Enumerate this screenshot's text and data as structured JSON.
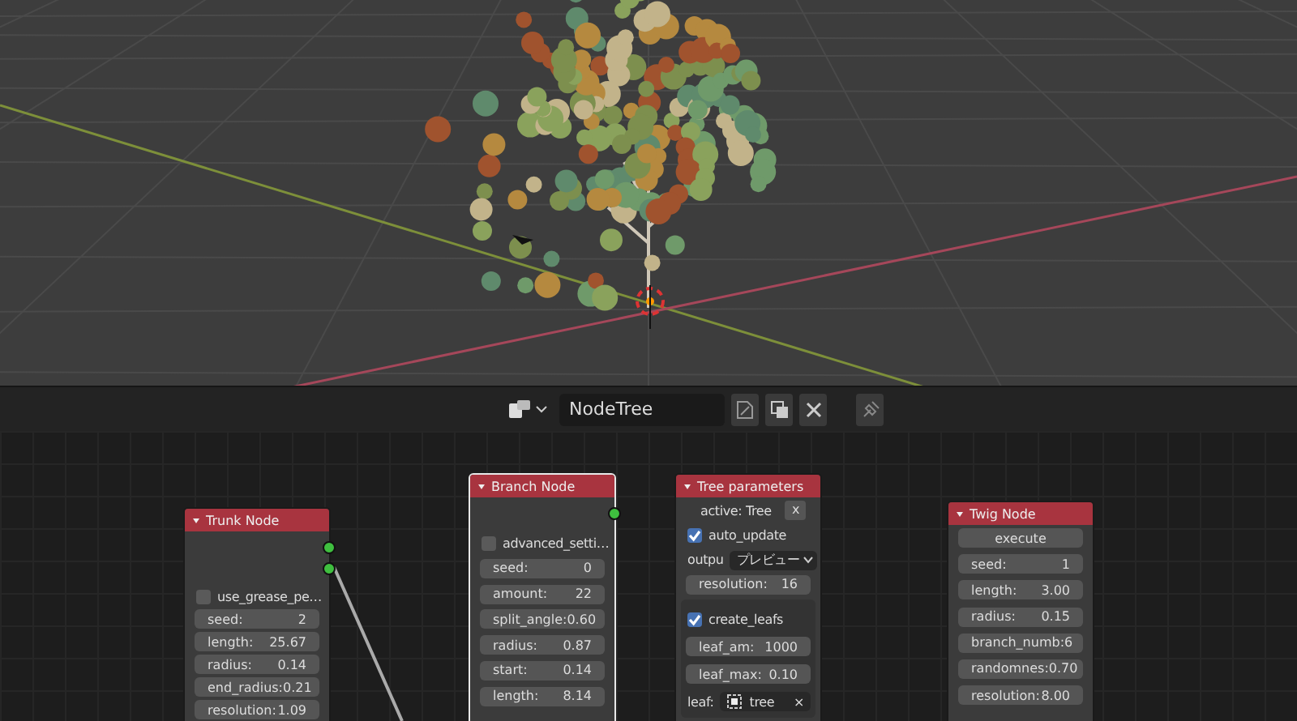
{
  "node_editor_header": {
    "tree_name": "NodeTree"
  },
  "nodes": [
    {
      "title": "Trunk Node",
      "selected": false,
      "rows": [
        {
          "kind": "checkbox",
          "label": "use_grease_pe…",
          "checked": false
        },
        {
          "kind": "field",
          "label": "seed:",
          "value": "2"
        },
        {
          "kind": "field",
          "label": "length:",
          "value": "25.67"
        },
        {
          "kind": "field",
          "label": "radius:",
          "value": "0.14"
        },
        {
          "kind": "field",
          "label": "end_radius:",
          "value": "0.21"
        },
        {
          "kind": "field",
          "label": "resolution:",
          "value": "1.09"
        }
      ]
    },
    {
      "title": "Branch Node",
      "selected": true,
      "rows": [
        {
          "kind": "checkbox",
          "label": "advanced_setti…",
          "checked": false
        },
        {
          "kind": "field",
          "label": "seed:",
          "value": "0"
        },
        {
          "kind": "field",
          "label": "amount:",
          "value": "22"
        },
        {
          "kind": "field",
          "label": "split_angle:",
          "value": "0.60"
        },
        {
          "kind": "field",
          "label": "radius:",
          "value": "0.87"
        },
        {
          "kind": "field",
          "label": "start:",
          "value": "0.14"
        },
        {
          "kind": "field",
          "label": "length:",
          "value": "8.14"
        }
      ]
    },
    {
      "title": "Tree parameters",
      "selected": false,
      "rows": [
        {
          "kind": "active",
          "label": "active: Tree",
          "button": "x"
        },
        {
          "kind": "checkbox",
          "label": "auto_update",
          "checked": true
        },
        {
          "kind": "dropdown",
          "label": "outpu",
          "value": "プレビュー"
        },
        {
          "kind": "field",
          "label": "resolution:",
          "value": "16"
        },
        {
          "kind": "panel",
          "rows": [
            {
              "kind": "checkbox",
              "label": "create_leafs",
              "checked": true
            },
            {
              "kind": "field",
              "label": "leaf_am:",
              "value": "1000"
            },
            {
              "kind": "field",
              "label": "leaf_max:",
              "value": "0.10"
            },
            {
              "kind": "datablock",
              "label": "leaf:",
              "value": "tree",
              "clear": "×"
            }
          ]
        }
      ]
    },
    {
      "title": "Twig Node",
      "selected": false,
      "rows": [
        {
          "kind": "button",
          "label": "execute"
        },
        {
          "kind": "field",
          "label": "seed:",
          "value": "1"
        },
        {
          "kind": "field",
          "label": "length:",
          "value": "3.00"
        },
        {
          "kind": "field",
          "label": "radius:",
          "value": "0.15"
        },
        {
          "kind": "field",
          "label": "branch_numb:",
          "value": "6"
        },
        {
          "kind": "field",
          "label": "randomnes:",
          "value": "0.70"
        },
        {
          "kind": "field",
          "label": "resolution:",
          "value": "8.00"
        }
      ]
    }
  ]
}
